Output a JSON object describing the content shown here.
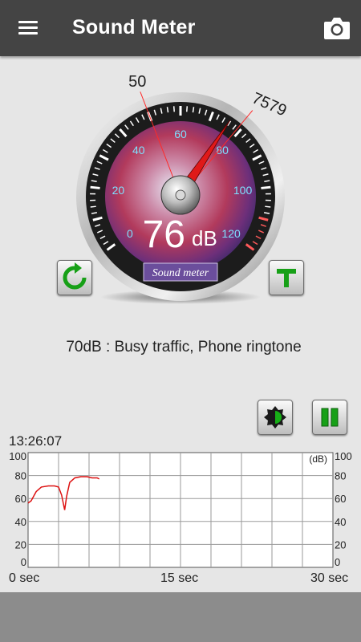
{
  "appbar": {
    "title": "Sound Meter",
    "menu_icon": "hamburger-menu-icon",
    "camera_icon": "camera-icon"
  },
  "gauge": {
    "current_db": "76",
    "unit": "dB",
    "min_marker": "50",
    "max_marker": "7579",
    "brand_label": "Sound meter",
    "scale_labels": [
      "0",
      "20",
      "40",
      "60",
      "80",
      "100",
      "120"
    ],
    "reading_value": 76,
    "min_marker_value": 50,
    "max_marker_value": 79
  },
  "description": "70dB : Busy traffic, Phone ringtone",
  "buttons": {
    "reset_icon": "refresh-icon",
    "top_icon": "t-letter-icon",
    "contrast_icon": "brightness-icon",
    "pause_icon": "pause-icon"
  },
  "graph": {
    "timestamp": "13:26:07",
    "unit_label": "(dB)",
    "y_ticks": [
      "100",
      "80",
      "60",
      "40",
      "20",
      "0"
    ],
    "x_labels": [
      "0 sec",
      "15 sec",
      "30 sec"
    ]
  },
  "chart_data": {
    "type": "line",
    "xlabel": "",
    "ylabel": "",
    "xlim": [
      0,
      30
    ],
    "ylim": [
      0,
      100
    ],
    "grid": true,
    "series": [
      {
        "color": "#dd1111",
        "x": [
          0,
          0.3,
          0.8,
          1.3,
          2.0,
          2.6,
          3.0,
          3.3,
          3.6,
          3.8,
          4.1,
          4.6,
          5.2,
          5.8,
          6.3,
          6.8,
          7.0
        ],
        "y": [
          56,
          58,
          66,
          70,
          71,
          71,
          70,
          63,
          50,
          62,
          74,
          78,
          79,
          79,
          78,
          78,
          77
        ]
      }
    ]
  },
  "colors": {
    "appbar": "#444444",
    "accent_green": "#17a017",
    "needle": "#e01919",
    "dial_cyan": "#7ee0ff"
  }
}
